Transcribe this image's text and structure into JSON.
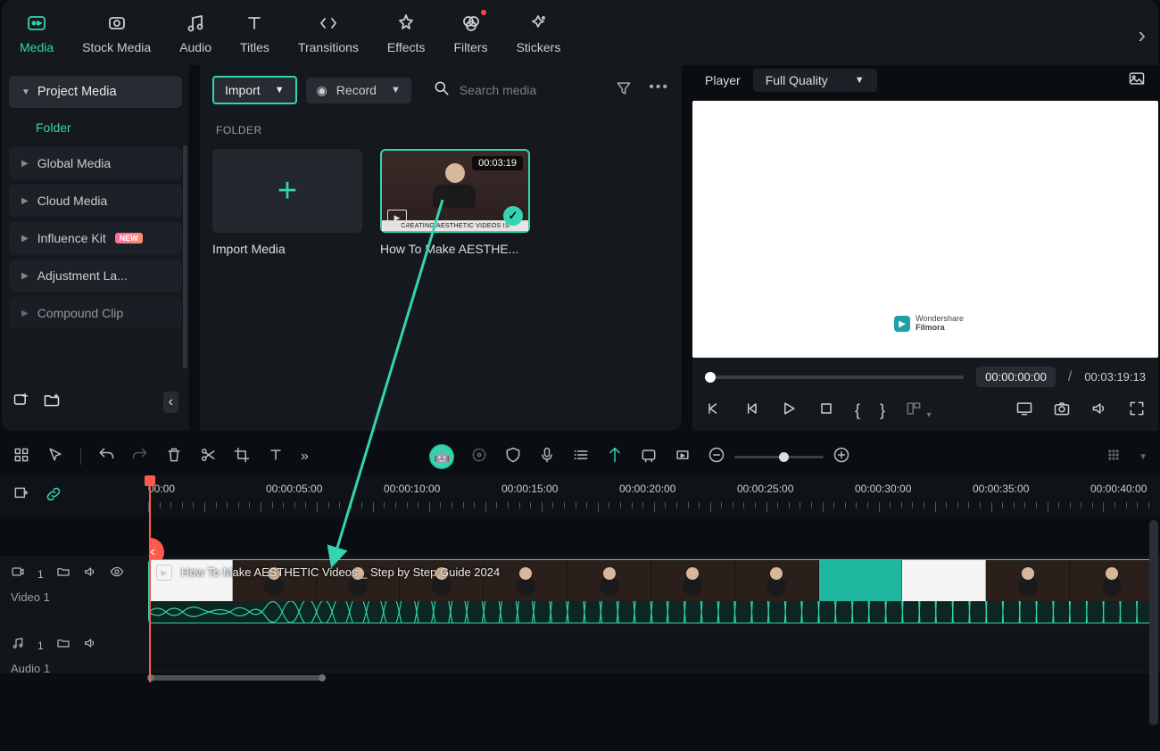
{
  "topTabs": {
    "media": "Media",
    "stockMedia": "Stock Media",
    "audio": "Audio",
    "titles": "Titles",
    "transitions": "Transitions",
    "effects": "Effects",
    "filters": "Filters",
    "stickers": "Stickers"
  },
  "sidebar": {
    "projectMedia": "Project Media",
    "folder": "Folder",
    "items": [
      {
        "label": "Global Media"
      },
      {
        "label": "Cloud Media"
      },
      {
        "label": "Influence Kit",
        "badge": "NEW"
      },
      {
        "label": "Adjustment La..."
      },
      {
        "label": "Compound Clip"
      }
    ]
  },
  "centerBar": {
    "importLabel": "Import",
    "recordLabel": "Record",
    "searchPlaceholder": "Search media"
  },
  "mediaSection": {
    "header": "FOLDER",
    "importTile": "Import Media",
    "clip": {
      "duration": "00:03:19",
      "label": "How To Make AESTHE..."
    }
  },
  "player": {
    "label": "Player",
    "quality": "Full Quality",
    "watermark": {
      "brand": "Wondershare",
      "product": "Filmora"
    },
    "currentTime": "00:00:00:00",
    "totalTime": "00:03:19:13",
    "sep": "/"
  },
  "timeline": {
    "marks": [
      "00:00",
      "00:00:05:00",
      "00:00:10:00",
      "00:00:15:00",
      "00:00:20:00",
      "00:00:25:00",
      "00:00:30:00",
      "00:00:35:00",
      "00:00:40:00"
    ],
    "tracks": {
      "video": {
        "num": "1",
        "name": "Video 1",
        "clipTitle": "How To Make AESTHETIC Videos _ Step by Step Guide 2024"
      },
      "audio": {
        "num": "1",
        "name": "Audio 1"
      }
    }
  }
}
